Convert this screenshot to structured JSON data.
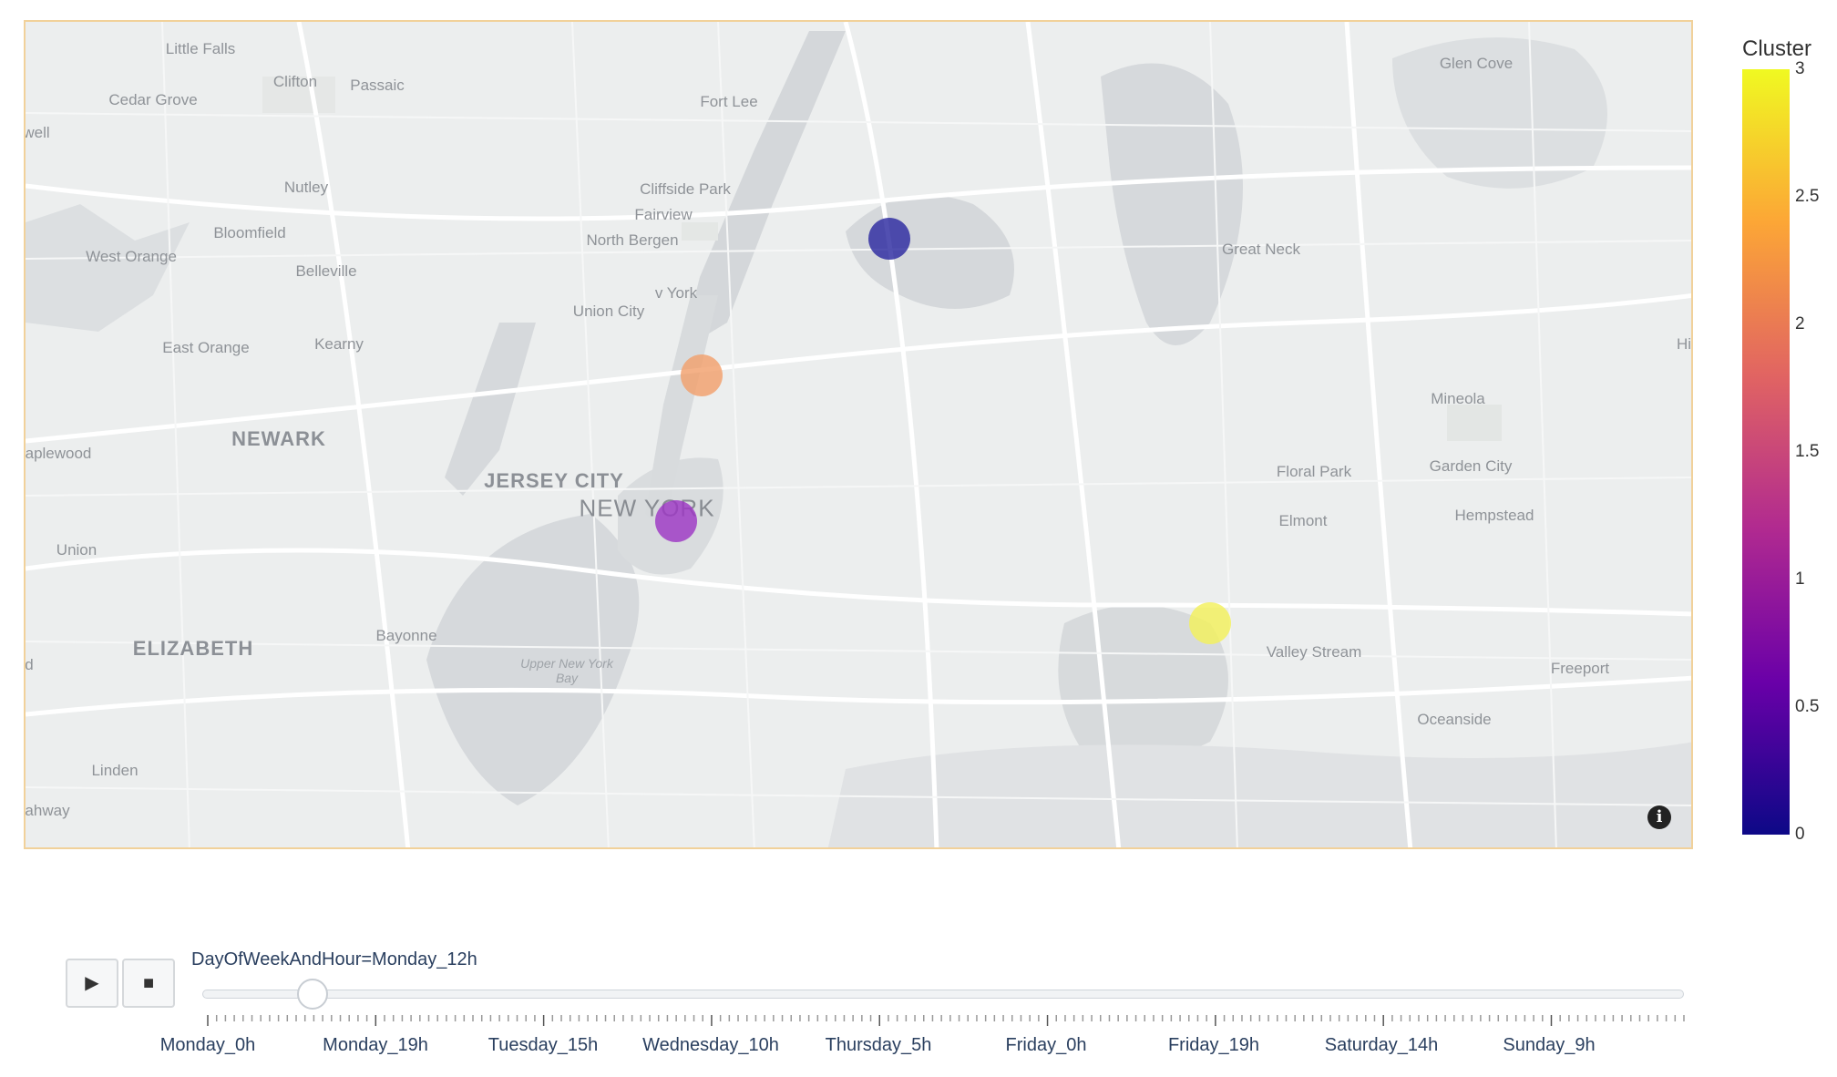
{
  "map": {
    "places": [
      {
        "name": "Little Falls",
        "kind": "town"
      },
      {
        "name": "Clifton",
        "kind": "town"
      },
      {
        "name": "Passaic",
        "kind": "town"
      },
      {
        "name": "Cedar Grove",
        "kind": "town"
      },
      {
        "name": "well",
        "kind": "town"
      },
      {
        "name": "Fort Lee",
        "kind": "town"
      },
      {
        "name": "Glen Cove",
        "kind": "town"
      },
      {
        "name": "Nutley",
        "kind": "town"
      },
      {
        "name": "Cliffside Park",
        "kind": "town"
      },
      {
        "name": "Fairview",
        "kind": "town"
      },
      {
        "name": "Bloomfield",
        "kind": "town"
      },
      {
        "name": "North Bergen",
        "kind": "town"
      },
      {
        "name": "West Orange",
        "kind": "town"
      },
      {
        "name": "Belleville",
        "kind": "town"
      },
      {
        "name": "Great Neck",
        "kind": "town"
      },
      {
        "name": "v York",
        "kind": "town"
      },
      {
        "name": "Union City",
        "kind": "town"
      },
      {
        "name": "East Orange",
        "kind": "town"
      },
      {
        "name": "Kearny",
        "kind": "town"
      },
      {
        "name": "Hi",
        "kind": "town"
      },
      {
        "name": "Mineola",
        "kind": "town"
      },
      {
        "name": "NEWARK",
        "kind": "big"
      },
      {
        "name": "aplewood",
        "kind": "town"
      },
      {
        "name": "Floral Park",
        "kind": "town"
      },
      {
        "name": "Garden City",
        "kind": "town"
      },
      {
        "name": "JERSEY CITY",
        "kind": "big"
      },
      {
        "name": "NEW YORK",
        "kind": "city"
      },
      {
        "name": "Elmont",
        "kind": "town"
      },
      {
        "name": "Hempstead",
        "kind": "town"
      },
      {
        "name": "Union",
        "kind": "town"
      },
      {
        "name": "ELIZABETH",
        "kind": "big"
      },
      {
        "name": "Bayonne",
        "kind": "town"
      },
      {
        "name": "Valley Stream",
        "kind": "town"
      },
      {
        "name": "Freeport",
        "kind": "town"
      },
      {
        "name": "d",
        "kind": "town"
      },
      {
        "name": "Upper New York Bay",
        "kind": "water"
      },
      {
        "name": "Oceanside",
        "kind": "town"
      },
      {
        "name": "Linden",
        "kind": "town"
      },
      {
        "name": "ahway",
        "kind": "town"
      }
    ],
    "markers": [
      {
        "cluster": 0,
        "color": "#2c2aa0"
      },
      {
        "cluster": 2,
        "color": "#f2a06c"
      },
      {
        "cluster": 1,
        "color": "#9e37c4"
      },
      {
        "cluster": 3,
        "color": "#f3f05c"
      }
    ],
    "info_icon": "info-icon"
  },
  "colorbar": {
    "title": "Cluster",
    "ticks": [
      "3",
      "2.5",
      "2",
      "1.5",
      "1",
      "0.5",
      "0"
    ],
    "colors": [
      "#0d0887",
      "#6a00a8",
      "#b12a90",
      "#e16462",
      "#fca636",
      "#f0f921"
    ]
  },
  "animation": {
    "play_icon": "play-icon",
    "stop_icon": "stop-icon",
    "play_glyph": "▶",
    "stop_glyph": "■",
    "current_label": "DayOfWeekAndHour=Monday_12h",
    "progress": 0.071,
    "tick_labels": [
      "Monday_0h",
      "Monday_19h",
      "Tuesday_15h",
      "Wednesday_10h",
      "Thursday_5h",
      "Friday_0h",
      "Friday_19h",
      "Saturday_14h",
      "Sunday_9h"
    ]
  }
}
